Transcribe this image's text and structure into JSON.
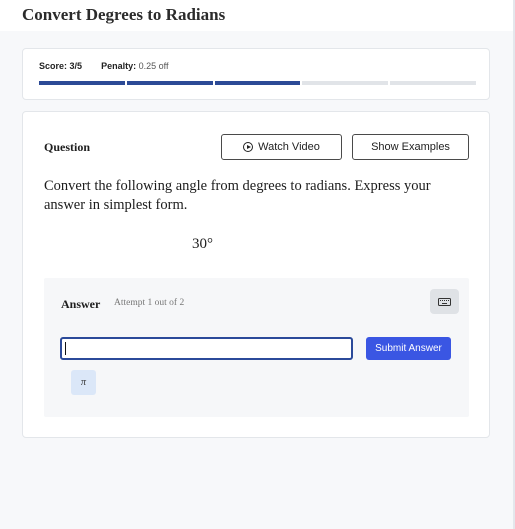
{
  "page": {
    "title": "Convert Degrees to Radians"
  },
  "score": {
    "score_label": "Score:",
    "score_value": "3/5",
    "penalty_label": "Penalty:",
    "penalty_value": "0.25 off",
    "progress": {
      "completed": 3,
      "total": 5
    }
  },
  "question": {
    "label": "Question",
    "watch_video_label": "Watch Video",
    "show_examples_label": "Show Examples",
    "prompt": "Convert the following angle from degrees to radians. Express your answer in simplest form.",
    "angle": "30°"
  },
  "answer": {
    "label": "Answer",
    "attempt": "Attempt 1 out of 2",
    "input_value": "",
    "submit_label": "Submit Answer",
    "pi_symbol": "π"
  },
  "icons": {
    "watch_video": "play-circle-icon",
    "keyboard": "keyboard-icon"
  },
  "colors": {
    "progress_filled": "#2c4a96",
    "progress_empty": "#e1e4e8",
    "submit": "#3a56e3",
    "input_border": "#2b4a9a",
    "pi_button": "#dbe7f8"
  }
}
